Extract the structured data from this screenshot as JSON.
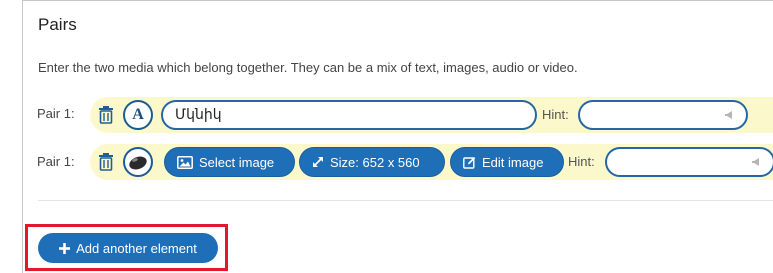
{
  "section": {
    "title": "Pairs",
    "description": "Enter the two media which belong together. They can be a mix of text, images, audio or video."
  },
  "pairs": [
    {
      "label": "Pair 1:",
      "type_icon": "text-type-icon",
      "type_glyph": "A",
      "text_value": "Մկնիկ",
      "hint_label": "Hint:",
      "hint_value": ""
    },
    {
      "label": "Pair 1:",
      "type_icon": "image-type-icon",
      "select_image_label": "Select image",
      "size_label": "Size: 652 x 560",
      "edit_image_label": "Edit image",
      "hint_label": "Hint:",
      "hint_value": ""
    }
  ],
  "actions": {
    "add_element_label": "Add another element"
  },
  "icons": {
    "delete": "trash-icon",
    "image": "picture-icon",
    "resize": "resize-arrows-icon",
    "edit": "edit-icon",
    "plus": "plus-icon",
    "audio": "speaker-icon"
  },
  "colors": {
    "accent": "#1f6fb8",
    "pair_background": "#fbf9cc",
    "highlight": "#e3182d"
  }
}
